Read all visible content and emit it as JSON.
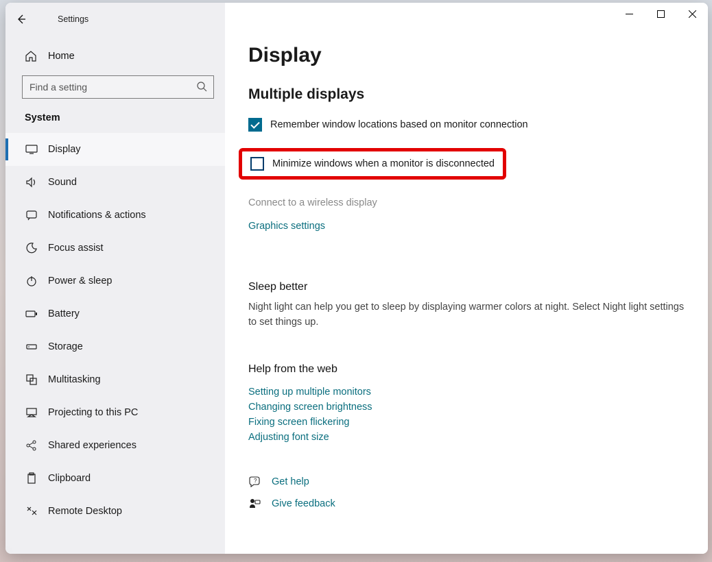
{
  "app": {
    "title": "Settings"
  },
  "home_label": "Home",
  "search": {
    "placeholder": "Find a setting"
  },
  "section_label": "System",
  "sidebar": {
    "items": [
      {
        "label": "Display",
        "icon": "display-icon",
        "active": true
      },
      {
        "label": "Sound",
        "icon": "sound-icon"
      },
      {
        "label": "Notifications & actions",
        "icon": "notifications-icon"
      },
      {
        "label": "Focus assist",
        "icon": "focus-assist-icon"
      },
      {
        "label": "Power & sleep",
        "icon": "power-icon"
      },
      {
        "label": "Battery",
        "icon": "battery-icon"
      },
      {
        "label": "Storage",
        "icon": "storage-icon"
      },
      {
        "label": "Multitasking",
        "icon": "multitasking-icon"
      },
      {
        "label": "Projecting to this PC",
        "icon": "projecting-icon"
      },
      {
        "label": "Shared experiences",
        "icon": "shared-icon"
      },
      {
        "label": "Clipboard",
        "icon": "clipboard-icon"
      },
      {
        "label": "Remote Desktop",
        "icon": "remote-desktop-icon"
      }
    ]
  },
  "page": {
    "title": "Display",
    "multiple_displays": {
      "heading": "Multiple displays",
      "remember_label": "Remember window locations based on monitor connection",
      "remember_checked": true,
      "minimize_label": "Minimize windows when a monitor is disconnected",
      "minimize_checked": false,
      "wireless_label": "Connect to a wireless display",
      "graphics_label": "Graphics settings"
    },
    "sleep_better": {
      "heading": "Sleep better",
      "body": "Night light can help you get to sleep by displaying warmer colors at night. Select Night light settings to set things up."
    },
    "help": {
      "heading": "Help from the web",
      "links": [
        "Setting up multiple monitors",
        "Changing screen brightness",
        "Fixing screen flickering",
        "Adjusting font size"
      ]
    },
    "footer": {
      "get_help": "Get help",
      "feedback": "Give feedback"
    }
  }
}
